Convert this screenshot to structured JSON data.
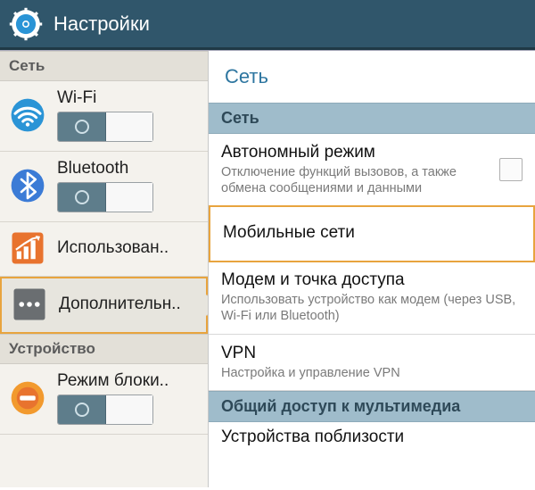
{
  "titlebar": {
    "title": "Настройки"
  },
  "sidebar": {
    "sections": [
      {
        "header": "Сеть"
      },
      {
        "header": "Устройство"
      }
    ],
    "items": {
      "wifi": {
        "label": "Wi-Fi"
      },
      "bluetooth": {
        "label": "Bluetooth"
      },
      "usage": {
        "label": "Использован.."
      },
      "more": {
        "label": "Дополнительн.."
      },
      "blocking": {
        "label": "Режим блоки.."
      }
    }
  },
  "content": {
    "title": "Сеть",
    "section_network": "Сеть",
    "section_sharing": "Общий доступ к мультимедиа",
    "rows": {
      "airplane": {
        "title": "Автономный режим",
        "sub": "Отключение функций вызовов, а также обмена сообщениями и данными"
      },
      "mobile": {
        "title": "Мобильные сети"
      },
      "tether": {
        "title": "Модем и точка доступа",
        "sub": "Использовать устройство как модем (через USB, Wi-Fi или Bluetooth)"
      },
      "vpn": {
        "title": "VPN",
        "sub": "Настройка и управление VPN"
      },
      "nearby": {
        "title": "Устройства поблизости"
      }
    }
  }
}
